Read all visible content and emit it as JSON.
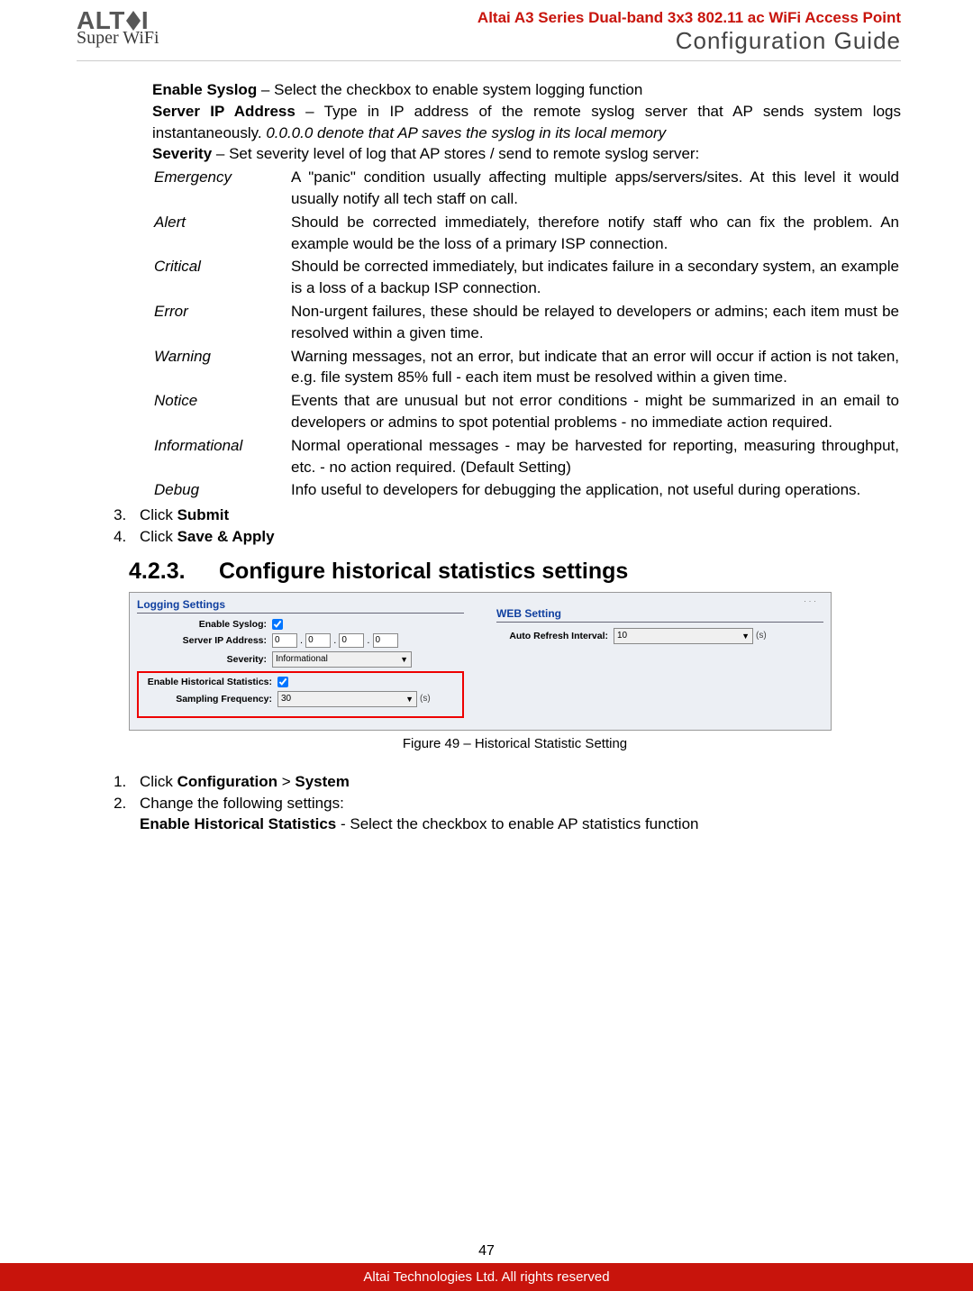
{
  "header": {
    "logo_main": "ALTAI",
    "logo_sub": "Super WiFi",
    "title_red": "Altai A3 Series Dual-band 3x3 802.11 ac WiFi Access Point",
    "title_big": "Configuration Guide"
  },
  "syslog": {
    "enable_label": "Enable Syslog",
    "enable_text": " – Select the checkbox to enable system logging function",
    "server_label": "Server IP Address",
    "server_text_a": " – Type in IP address of the remote syslog server that AP sends system logs instantaneously. ",
    "server_text_b": "0.0.0.0 denote that AP saves the syslog in its local memory",
    "severity_label": "Severity",
    "severity_text": " – Set severity level of log that AP stores / send to remote syslog server:"
  },
  "severity_levels": [
    {
      "term": "Emergency",
      "desc": "A \"panic\" condition usually affecting multiple apps/servers/sites. At this level it would usually notify all tech staff on call."
    },
    {
      "term": "Alert",
      "desc": "Should be corrected immediately, therefore notify staff who can fix the problem. An example would be the loss of a primary ISP connection."
    },
    {
      "term": "Critical",
      "desc": "Should be corrected immediately, but indicates failure in a secondary system, an example is a loss of a backup ISP connection."
    },
    {
      "term": "Error",
      "desc": "Non-urgent failures, these should be relayed to developers or admins; each item must be resolved within a given time."
    },
    {
      "term": "Warning",
      "desc": "Warning messages, not an error, but indicate that an error will occur if action is not taken, e.g. file system 85% full - each item must be resolved within a given time."
    },
    {
      "term": "Notice",
      "desc": "Events that are unusual but not error conditions - might be summarized in an email to developers or admins to spot potential problems - no immediate action required."
    },
    {
      "term": "Informational",
      "desc": "Normal operational messages - may be harvested for reporting, measuring throughput, etc. - no action required. (Default Setting)"
    },
    {
      "term": "Debug",
      "desc": "Info useful to developers for debugging the application, not useful during operations."
    }
  ],
  "steps_a": [
    {
      "prefix": "Click ",
      "bold": "Submit"
    },
    {
      "prefix": "Click ",
      "bold": "Save & Apply"
    }
  ],
  "heading": {
    "num": "4.2.3.",
    "text": "Configure historical statistics settings"
  },
  "figure": {
    "left_title": "Logging Settings",
    "right_title": "WEB Setting",
    "enable_syslog": "Enable Syslog:",
    "server_ip": "Server IP Address:",
    "ip_octet": "0",
    "severity": "Severity:",
    "severity_val": "Informational",
    "enable_hist": "Enable Historical Statistics:",
    "sampling": "Sampling Frequency:",
    "sampling_val": "30",
    "sampling_unit": "(s)",
    "auto_refresh": "Auto Refresh Interval:",
    "auto_refresh_val": "10",
    "auto_refresh_unit": "(s)"
  },
  "caption": "Figure 49 – Historical Statistic Setting",
  "steps_b": {
    "s1_a": "Click ",
    "s1_b": "Configuration",
    "s1_c": " > ",
    "s1_d": "System",
    "s2": "Change the following settings:",
    "s2b_label": "Enable Historical Statistics",
    "s2b_text": " - Select the checkbox to enable AP statistics function"
  },
  "page_num": "47",
  "footer": "Altai Technologies Ltd. All rights reserved"
}
